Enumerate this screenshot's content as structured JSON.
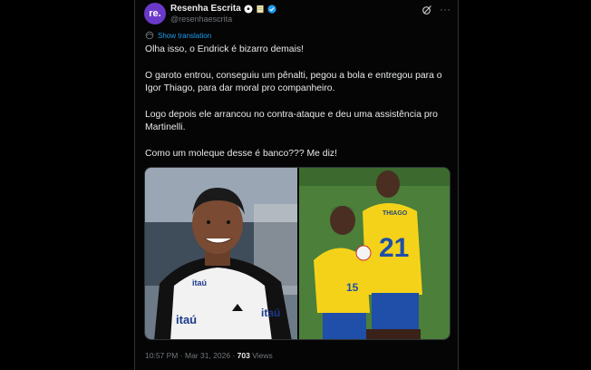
{
  "author": {
    "avatar_text": "re.",
    "display_name": "Resenha Escrita",
    "handle": "@resenhaescrita"
  },
  "translate": {
    "label": "Show translation"
  },
  "tweet": {
    "paragraphs": [
      "Olha isso, o Endrick é bizarro demais!",
      "O garoto entrou, conseguiu um pênalti, pegou a bola e entregou para o Igor Thiago, para dar moral pro companheiro.",
      "Logo depois ele arrancou no contra-ataque e deu uma assistência pro Martinelli.",
      "Como um moleque desse é banco??? Me diz!"
    ]
  },
  "media": {
    "left_image": {
      "sponsor_1": "itaú",
      "sponsor_2": "itaú",
      "sponsor_3": "itaú"
    },
    "right_image": {
      "name_on_shirt": "THIAGO",
      "number_back": "21",
      "number_front": "15"
    }
  },
  "meta": {
    "time": "10:57 PM",
    "separator": "·",
    "date": "Mar 31, 2026",
    "views_count": "703",
    "views_label": "Views"
  },
  "colors": {
    "accent": "#1d9bf0",
    "avatar": "#6b39c9",
    "text": "#e7e9ea",
    "muted": "#71767b"
  }
}
